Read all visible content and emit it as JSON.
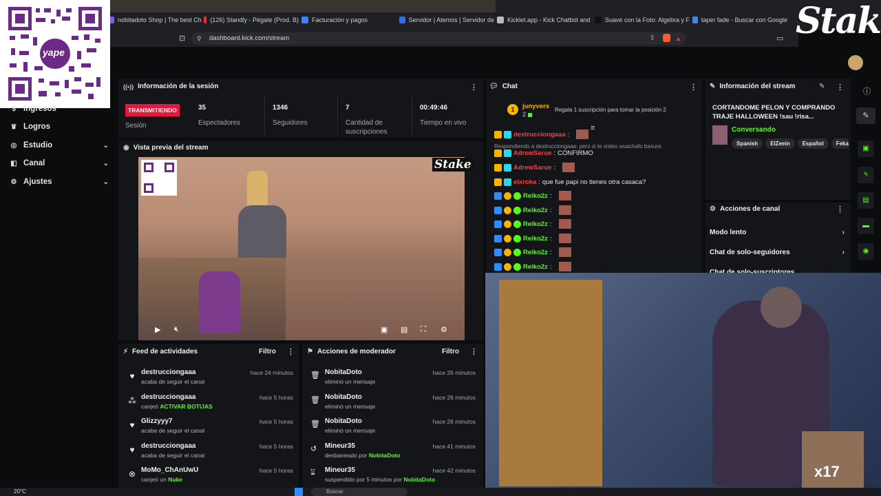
{
  "browser": {
    "tabs": [
      {
        "label": "nobitadoto Shop | The best Ch",
        "color": "#7a58ff"
      },
      {
        "label": "(126) Standly - Pégate (Prod. B)",
        "color": "#ff2b2b"
      },
      {
        "label": "Facturación y pagos",
        "color": "#3b82f6"
      },
      {
        "label": "Servidor | Atemos | Servidor de",
        "color": "#2f6fe0"
      },
      {
        "label": "Kicklet.app - Kick Chatbot and",
        "color": "#bbbbbb"
      },
      {
        "label": "Suave con la Foto: Algebra y F",
        "color": "#111111"
      },
      {
        "label": "taper fade - Buscar con Google",
        "color": "#4285f4"
      }
    ],
    "url": "dashboard.kick.com/stream"
  },
  "overlay": {
    "sponsor": "Stake",
    "qr_brand": "yape",
    "preview_sponsor": "Stake"
  },
  "sidebar": {
    "items": [
      {
        "label": "Ingresos",
        "icon": "dollar-icon",
        "expandable": false
      },
      {
        "label": "Logros",
        "icon": "trophy-icon",
        "expandable": false
      },
      {
        "label": "Estudio",
        "icon": "studio-icon",
        "expandable": true
      },
      {
        "label": "Canal",
        "icon": "channel-icon",
        "expandable": true
      },
      {
        "label": "Ajustes",
        "icon": "gear-icon",
        "expandable": true
      }
    ]
  },
  "session": {
    "title": "Información de la sesión",
    "live_badge": "TRANSMITIENDO",
    "session_label": "Sesión",
    "stats": [
      {
        "value": "35",
        "label": "Espectadores"
      },
      {
        "value": "1346",
        "label": "Seguidores"
      },
      {
        "value": "7",
        "label": "Cantidad de suscripciones"
      },
      {
        "value": "00:49:46",
        "label": "Tiempo en vivo"
      }
    ]
  },
  "preview": {
    "title": "Vista previa del stream"
  },
  "activity": {
    "title": "Feed de actividades",
    "filter": "Filtro",
    "items": [
      {
        "icon": "heart-icon",
        "name": "destrucciongaaa",
        "action": "acaba de seguir el canal",
        "highlight": "",
        "time": "hace 24 minutos"
      },
      {
        "icon": "bubbles-icon",
        "name": "destrucciongaaa",
        "action": "canjeó ",
        "highlight": "ACTIVAR BOTIJAS",
        "time": "hace 5 horas"
      },
      {
        "icon": "heart-icon",
        "name": "Glizzyyy7",
        "action": "acaba de seguir el canal",
        "highlight": "",
        "time": "hace 5 horas"
      },
      {
        "icon": "heart-icon",
        "name": "destrucciongaaa",
        "action": "acaba de seguir el canal",
        "highlight": "",
        "time": "hace 5 horas"
      },
      {
        "icon": "kick-icon",
        "name": "MoMo_ChAnUwU",
        "action": "canjeó un ",
        "highlight": "Nuke",
        "time": "hace 5 horas"
      }
    ]
  },
  "moderation": {
    "title": "Acciones de moderador",
    "filter": "Filtro",
    "items": [
      {
        "icon": "trash-icon",
        "name": "NobitaDoto",
        "action": "eliminó un mensaje",
        "by": "",
        "time": "hace 26 minutos"
      },
      {
        "icon": "trash-icon",
        "name": "NobitaDoto",
        "action": "eliminó un mensaje",
        "by": "",
        "time": "hace 26 minutos"
      },
      {
        "icon": "trash-icon",
        "name": "NobitaDoto",
        "action": "eliminó un mensaje",
        "by": "",
        "time": "hace 26 minutos"
      },
      {
        "icon": "unban-icon",
        "name": "Mineur35",
        "action": "desbaneado por ",
        "by": "NobitaDoto",
        "time": "hace 41 minutos"
      },
      {
        "icon": "hourglass-icon",
        "name": "Mineur35",
        "action": "suspendido por 5 minutos por ",
        "by": "NobitaDoto",
        "time": "hace 42 minutos"
      }
    ]
  },
  "chat": {
    "title": "Chat",
    "pinned": {
      "rank": "1",
      "user": "junyvers",
      "count": "2",
      "text": "Regala 1 suscripción para tomar la posición 2"
    },
    "reply_note": "Respondiendo a destrucciongaaa: pero si te vistes wuachafo basura",
    "messages": [
      {
        "user": "destrucciongaaa",
        "color": "#ff3b3b",
        "text": ""
      },
      {
        "user": "AdrewSarue",
        "color": "#ff3b3b",
        "text": " CONFIRMO"
      },
      {
        "user": "AdrewSarue",
        "color": "#ff3b3b",
        "text": ""
      },
      {
        "user": "elxroka",
        "color": "#ff3b3b",
        "text": " que fue papi no tienes otra casaca?"
      },
      {
        "user": "Reiko2z",
        "color": "#53fc18",
        "text": ""
      },
      {
        "user": "Reiko2z",
        "color": "#53fc18",
        "text": ""
      },
      {
        "user": "Reiko2z",
        "color": "#53fc18",
        "text": ""
      },
      {
        "user": "Reiko2z",
        "color": "#53fc18",
        "text": ""
      },
      {
        "user": "Reiko2z",
        "color": "#53fc18",
        "text": ""
      },
      {
        "user": "Reiko2z",
        "color": "#53fc18",
        "text": ""
      }
    ]
  },
  "stream_info": {
    "title": "Información del stream",
    "stream_title": "CORTANDOME PELON Y COMPRANDO TRAJE HALLOWEEN !sau !risa...",
    "category": "Conversando",
    "tags": [
      "Spanish",
      "ElZeein",
      "Español",
      "Feka"
    ]
  },
  "channel_actions": {
    "title": "Acciones de canal",
    "items": [
      "Modo lento",
      "Chat de solo-seguidores",
      "Chat de solo-suscriptores"
    ]
  },
  "taskbar": {
    "weather": "20°C",
    "search_placeholder": "Buscar"
  },
  "webcam": {
    "overlay_text": "x17"
  }
}
